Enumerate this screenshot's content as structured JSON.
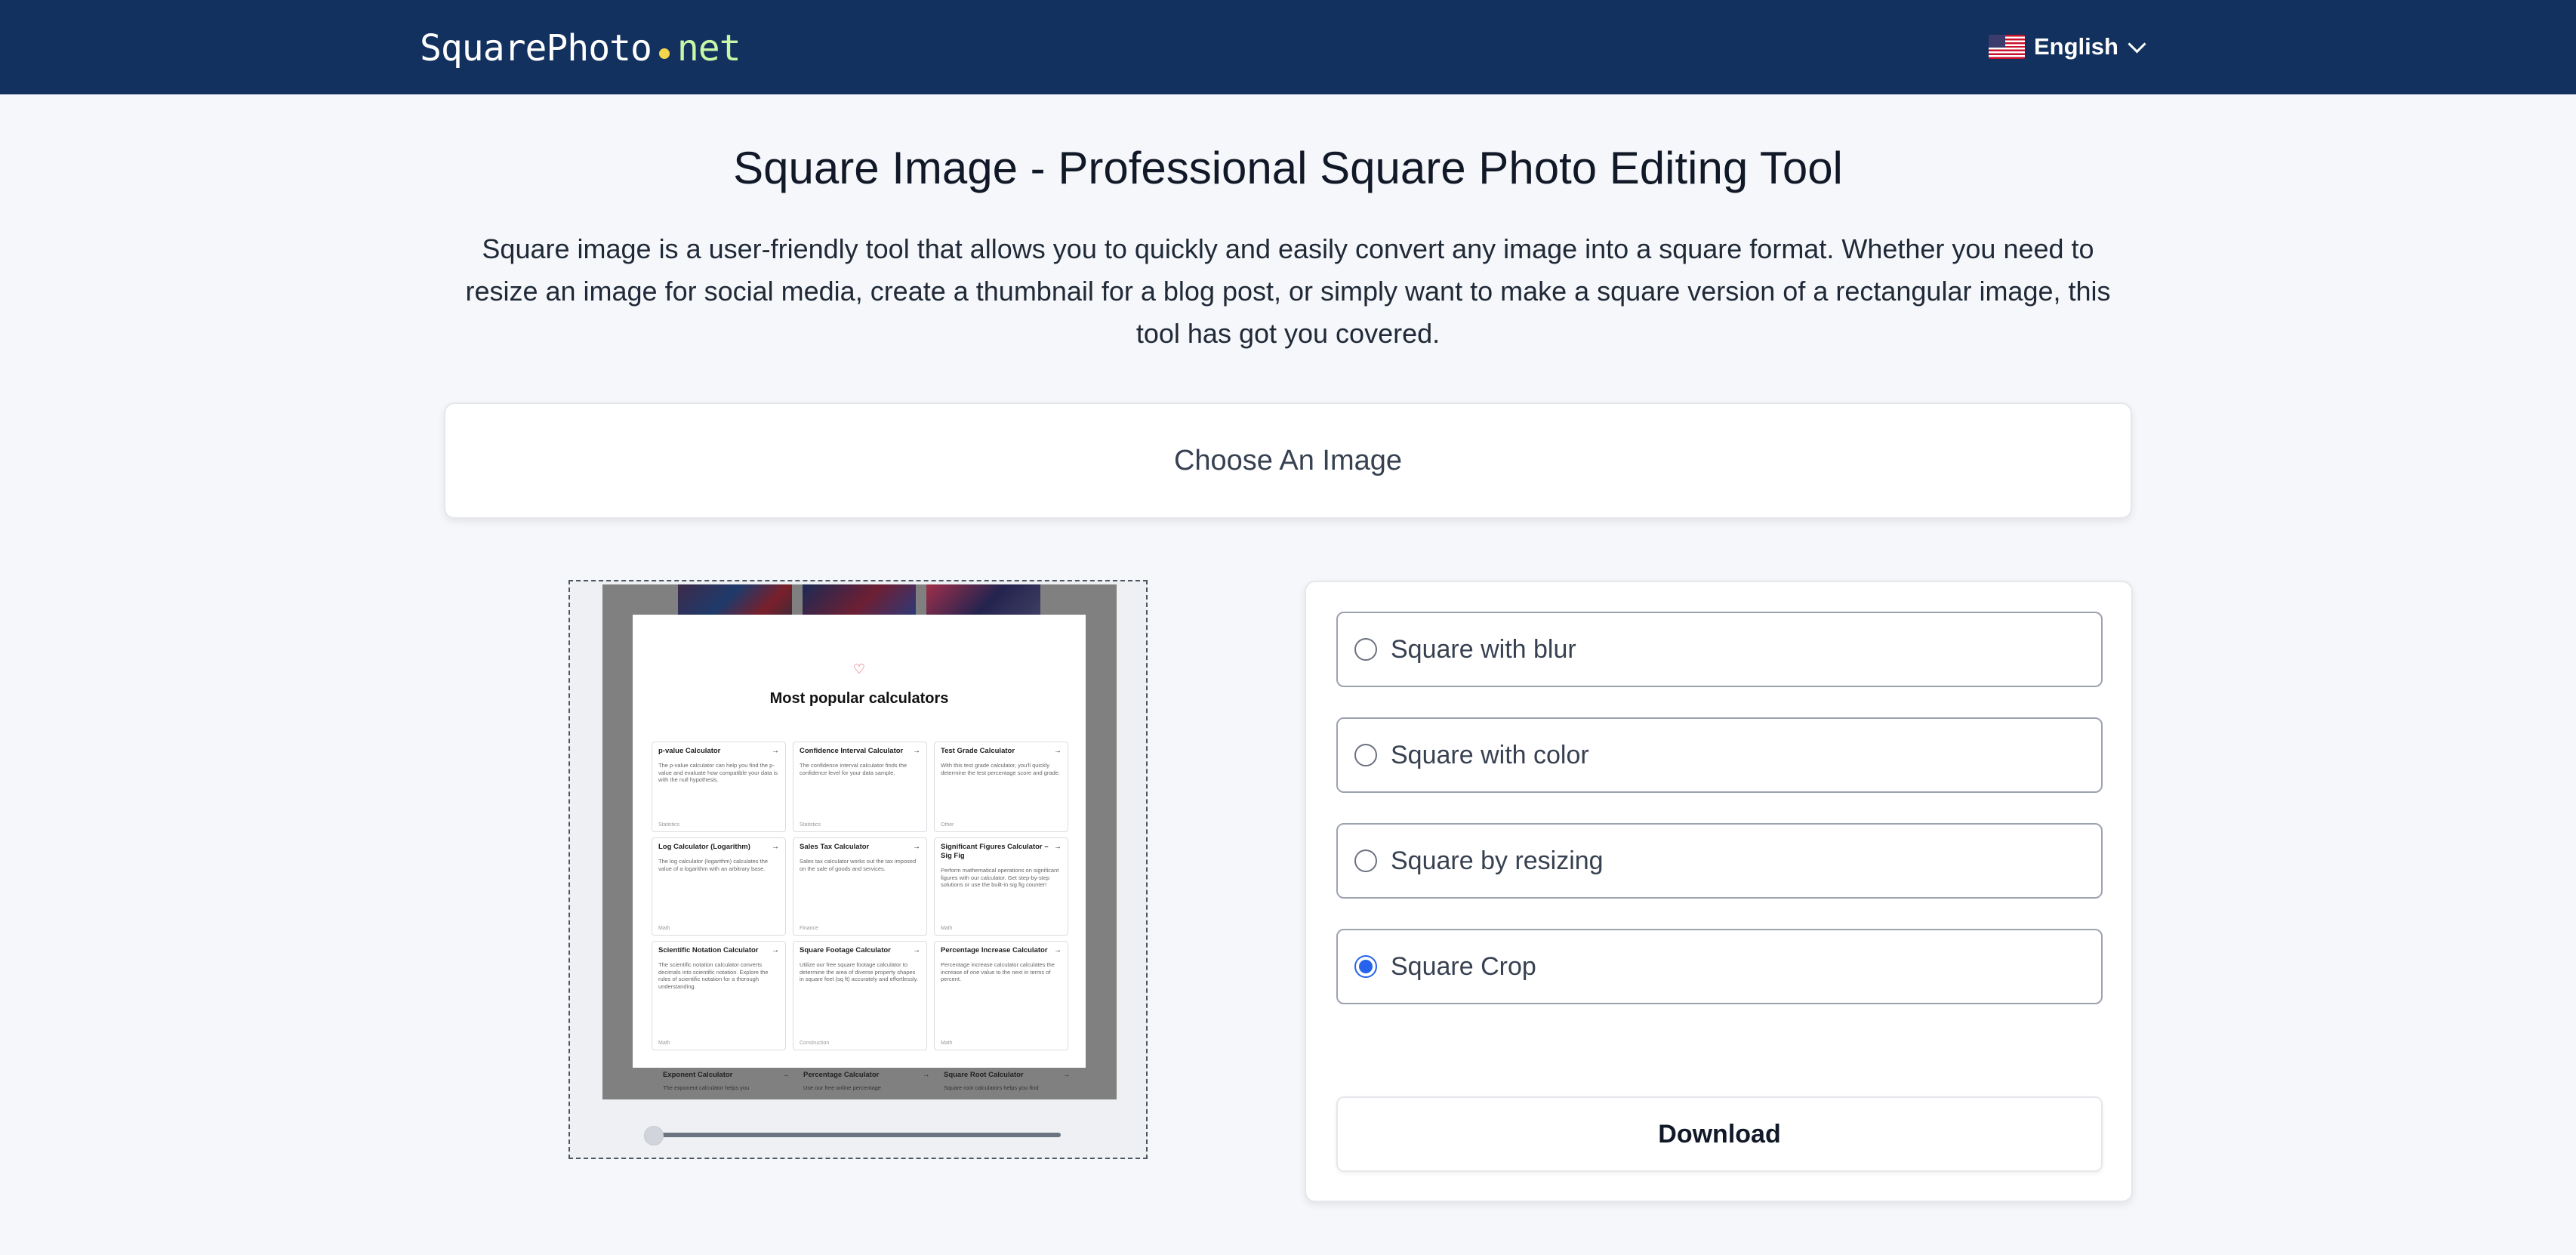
{
  "header": {
    "logo_text": "SquarePhoto",
    "logo_tld": "net",
    "logo_tld_color": "#c8f7a7",
    "logo_dot_color": "#f2d54a",
    "background_color": "#12315e",
    "language": "English"
  },
  "main": {
    "title": "Square Image - Professional Square Photo Editing Tool",
    "intro": "Square image is a user-friendly tool that allows you to quickly and easily convert any image into a square format. Whether you need to resize an image for social media, create a thumbnail for a blog post, or simply want to make a square version of a rectangular image, this tool has got you covered.",
    "choose_label": "Choose An Image"
  },
  "preview": {
    "heading": "Most popular calculators",
    "cards": [
      {
        "title": "p-value Calculator",
        "desc": "The p-value calculator can help you find the p-value and evaluate how compatible your data is with the null hypothesis.",
        "category": "Statistics"
      },
      {
        "title": "Confidence Interval Calculator",
        "desc": "The confidence interval calculator finds the confidence level for your data sample.",
        "category": "Statistics"
      },
      {
        "title": "Test Grade Calculator",
        "desc": "With this test grade calculator, you'll quickly determine the test percentage score and grade.",
        "category": "Other"
      },
      {
        "title": "Log Calculator (Logarithm)",
        "desc": "The log calculator (logarithm) calculates the value of a logarithm with an arbitrary base.",
        "category": "Math"
      },
      {
        "title": "Sales Tax Calculator",
        "desc": "Sales tax calculator works out the tax imposed on the sale of goods and services.",
        "category": "Finance"
      },
      {
        "title": "Significant Figures Calculator – Sig Fig",
        "desc": "Perform mathematical operations on significant figures with our calculator. Get step-by-step solutions or use the built-in sig fig counter!",
        "category": "Math"
      },
      {
        "title": "Scientific Notation Calculator",
        "desc": "The scientific notation calculator converts decimals into scientific notation. Explore the rules of scientific notation for a thorough understanding.",
        "category": "Math"
      },
      {
        "title": "Square Footage Calculator",
        "desc": "Utilize our free square footage calculator to determine the area of diverse property shapes in square feet (sq ft) accurately and effortlessly.",
        "category": "Construction"
      },
      {
        "title": "Percentage Increase Calculator",
        "desc": "Percentage increase calculator calculates the increase of one value to the next in terms of percent.",
        "category": "Math"
      }
    ],
    "peek": [
      {
        "title": "Exponent Calculator",
        "desc": "The exponent calculator helps you"
      },
      {
        "title": "Percentage Calculator",
        "desc": "Use our free online percentage"
      },
      {
        "title": "Square Root Calculator",
        "desc": "Square root calculators helps you find"
      }
    ],
    "slider_value": 0
  },
  "options": {
    "items": [
      {
        "label": "Square with blur",
        "checked": false
      },
      {
        "label": "Square with color",
        "checked": false
      },
      {
        "label": "Square by resizing",
        "checked": false
      },
      {
        "label": "Square Crop",
        "checked": true
      }
    ],
    "accent_color": "#2563eb",
    "download_label": "Download"
  }
}
